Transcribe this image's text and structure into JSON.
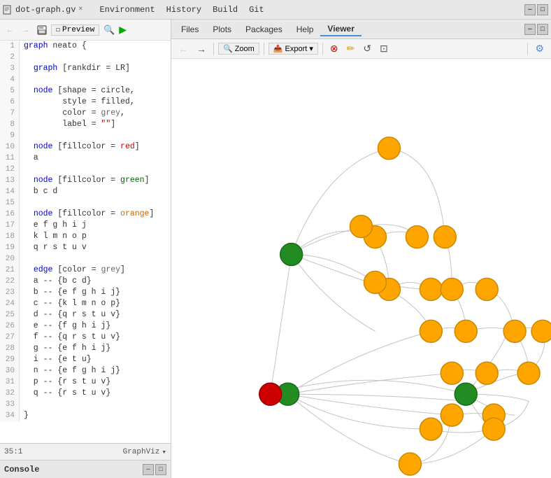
{
  "app": {
    "title": "dot-graph.gv",
    "tab_close": "×"
  },
  "menubar": {
    "items": [
      "Environment",
      "History",
      "Build",
      "Git"
    ]
  },
  "right_menubar": {
    "items": [
      "Files",
      "Plots",
      "Packages",
      "Help",
      "Viewer"
    ]
  },
  "editor_toolbar": {
    "preview_label": "Preview",
    "run_icon": "▶"
  },
  "viewer_toolbar": {
    "zoom_label": "Zoom",
    "export_label": "Export",
    "export_arrow": "▾"
  },
  "statusbar": {
    "position": "35:1",
    "engine": "GraphViz"
  },
  "console": {
    "label": "Console"
  },
  "code_lines": [
    {
      "num": 1,
      "text": "graph neato {"
    },
    {
      "num": 2,
      "text": ""
    },
    {
      "num": 3,
      "text": "  graph [rankdir = LR]"
    },
    {
      "num": 4,
      "text": ""
    },
    {
      "num": 5,
      "text": "  node [shape = circle,"
    },
    {
      "num": 6,
      "text": "        style = filled,"
    },
    {
      "num": 7,
      "text": "        color = grey,"
    },
    {
      "num": 8,
      "text": "        label = \"\"]"
    },
    {
      "num": 9,
      "text": ""
    },
    {
      "num": 10,
      "text": "  node [fillcolor = red]"
    },
    {
      "num": 11,
      "text": "  a"
    },
    {
      "num": 12,
      "text": ""
    },
    {
      "num": 13,
      "text": "  node [fillcolor = green]"
    },
    {
      "num": 14,
      "text": "  b c d"
    },
    {
      "num": 15,
      "text": ""
    },
    {
      "num": 16,
      "text": "  node [fillcolor = orange]"
    },
    {
      "num": 17,
      "text": "  e f g h i j"
    },
    {
      "num": 18,
      "text": "  k l m n o p"
    },
    {
      "num": 19,
      "text": "  q r s t u v"
    },
    {
      "num": 20,
      "text": ""
    },
    {
      "num": 21,
      "text": "  edge [color = grey]"
    },
    {
      "num": 22,
      "text": "  a -- {b c d}"
    },
    {
      "num": 23,
      "text": "  b -- {e f g h i j}"
    },
    {
      "num": 24,
      "text": "  c -- {k l m n o p}"
    },
    {
      "num": 25,
      "text": "  d -- {q r s t u v}"
    },
    {
      "num": 26,
      "text": "  e -- {f g h i j}"
    },
    {
      "num": 27,
      "text": "  f -- {q r s t u v}"
    },
    {
      "num": 28,
      "text": "  g -- {e f h i j}"
    },
    {
      "num": 29,
      "text": "  i -- {e t u}"
    },
    {
      "num": 30,
      "text": "  n -- {e f g h i j}"
    },
    {
      "num": 31,
      "text": "  p -- {r s t u v}"
    },
    {
      "num": 32,
      "text": "  q -- {r s t u v}"
    },
    {
      "num": 33,
      "text": ""
    },
    {
      "num": 34,
      "text": "}"
    }
  ],
  "colors": {
    "orange": "#FFA500",
    "green": "#228B22",
    "red": "#CC0000",
    "edge": "#999999",
    "bg": "#ffffff"
  }
}
